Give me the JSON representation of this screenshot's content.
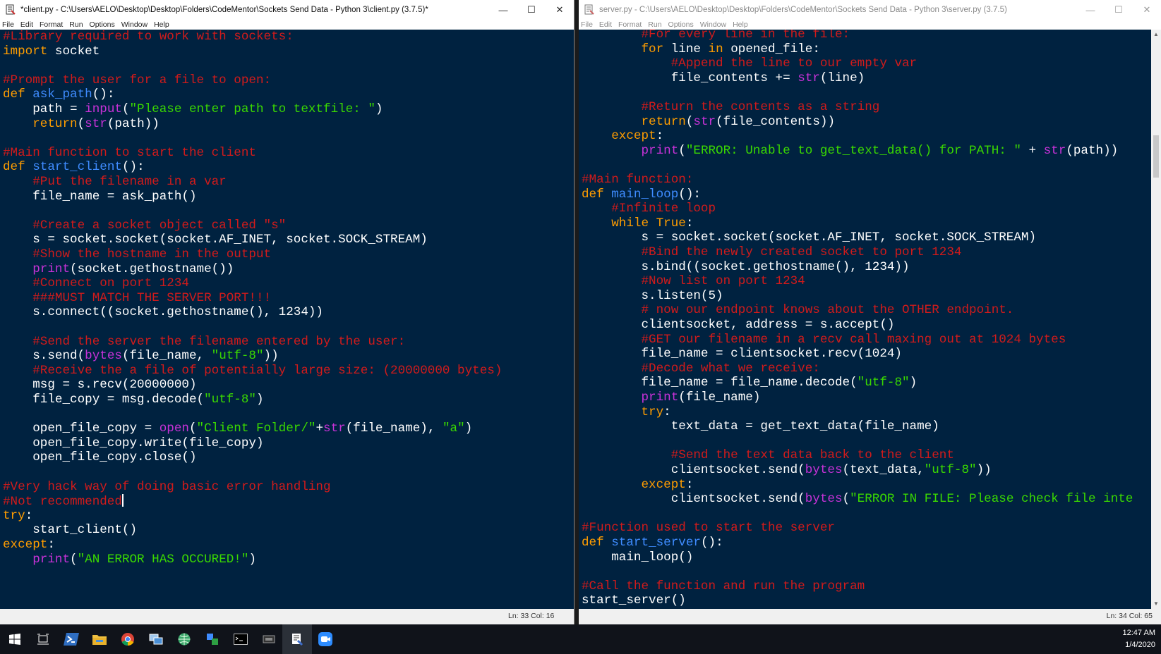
{
  "left_window": {
    "title": "*client.py - C:\\Users\\AELO\\Desktop\\Desktop\\Folders\\CodeMentor\\Sockets Send Data - Python 3\\client.py (3.7.5)*",
    "menu": [
      "File",
      "Edit",
      "Format",
      "Run",
      "Options",
      "Window",
      "Help"
    ],
    "controls": {
      "minimize": "—",
      "maximize": "☐",
      "close": "✕"
    },
    "status": "Ln: 33  Col: 16",
    "lines": [
      [
        [
          "c",
          "#Library required to work with sockets:"
        ]
      ],
      [
        [
          "k",
          "import"
        ],
        [
          "t",
          " socket"
        ]
      ],
      [],
      [
        [
          "c",
          "#Prompt the user for a file to open:"
        ]
      ],
      [
        [
          "k",
          "def"
        ],
        [
          "t",
          " "
        ],
        [
          "d",
          "ask_path"
        ],
        [
          "t",
          "():"
        ]
      ],
      [
        [
          "t",
          "    path = "
        ],
        [
          "b",
          "input"
        ],
        [
          "t",
          "("
        ],
        [
          "s",
          "\"Please enter path to textfile: \""
        ],
        [
          "t",
          ")"
        ]
      ],
      [
        [
          "t",
          "    "
        ],
        [
          "k",
          "return"
        ],
        [
          "t",
          "("
        ],
        [
          "b",
          "str"
        ],
        [
          "t",
          "(path))"
        ]
      ],
      [],
      [
        [
          "c",
          "#Main function to start the client"
        ]
      ],
      [
        [
          "k",
          "def"
        ],
        [
          "t",
          " "
        ],
        [
          "d",
          "start_client"
        ],
        [
          "t",
          "():"
        ]
      ],
      [
        [
          "t",
          "    "
        ],
        [
          "c",
          "#Put the filename in a var"
        ]
      ],
      [
        [
          "t",
          "    file_name = ask_path()"
        ]
      ],
      [],
      [
        [
          "t",
          "    "
        ],
        [
          "c",
          "#Create a socket object called \"s\""
        ]
      ],
      [
        [
          "t",
          "    s = socket.socket(socket.AF_INET, socket.SOCK_STREAM)"
        ]
      ],
      [
        [
          "t",
          "    "
        ],
        [
          "c",
          "#Show the hostname in the output"
        ]
      ],
      [
        [
          "t",
          "    "
        ],
        [
          "b",
          "print"
        ],
        [
          "t",
          "(socket.gethostname())"
        ]
      ],
      [
        [
          "t",
          "    "
        ],
        [
          "c",
          "#Connect on port 1234"
        ]
      ],
      [
        [
          "t",
          "    "
        ],
        [
          "c",
          "###MUST MATCH THE SERVER PORT!!!"
        ]
      ],
      [
        [
          "t",
          "    s.connect((socket.gethostname(), 1234))"
        ]
      ],
      [],
      [
        [
          "t",
          "    "
        ],
        [
          "c",
          "#Send the server the filename entered by the user:"
        ]
      ],
      [
        [
          "t",
          "    s.send("
        ],
        [
          "b",
          "bytes"
        ],
        [
          "t",
          "(file_name, "
        ],
        [
          "s",
          "\"utf-8\""
        ],
        [
          "t",
          "))"
        ]
      ],
      [
        [
          "t",
          "    "
        ],
        [
          "c",
          "#Receive the a file of potentially large size: (20000000 bytes)"
        ]
      ],
      [
        [
          "t",
          "    msg = s.recv(20000000)"
        ]
      ],
      [
        [
          "t",
          "    file_copy = msg.decode("
        ],
        [
          "s",
          "\"utf-8\""
        ],
        [
          "t",
          ")"
        ]
      ],
      [],
      [
        [
          "t",
          "    open_file_copy = "
        ],
        [
          "b",
          "open"
        ],
        [
          "t",
          "("
        ],
        [
          "s",
          "\"Client Folder/\""
        ],
        [
          "t",
          "+"
        ],
        [
          "b",
          "str"
        ],
        [
          "t",
          "(file_name), "
        ],
        [
          "s",
          "\"a\""
        ],
        [
          "t",
          ")"
        ]
      ],
      [
        [
          "t",
          "    open_file_copy.write(file_copy)"
        ]
      ],
      [
        [
          "t",
          "    open_file_copy.close()"
        ]
      ],
      [],
      [
        [
          "c",
          "#Very hack way of doing basic error handling"
        ]
      ],
      [
        [
          "c",
          "#Not recommended"
        ],
        [
          "cursor",
          ""
        ]
      ],
      [
        [
          "k",
          "try"
        ],
        [
          "t",
          ":"
        ]
      ],
      [
        [
          "t",
          "    start_client()"
        ]
      ],
      [
        [
          "k",
          "except"
        ],
        [
          "t",
          ":"
        ]
      ],
      [
        [
          "t",
          "    "
        ],
        [
          "b",
          "print"
        ],
        [
          "t",
          "("
        ],
        [
          "s",
          "\"AN ERROR HAS OCCURED!\""
        ],
        [
          "t",
          ")"
        ]
      ]
    ]
  },
  "right_window": {
    "title": "server.py - C:\\Users\\AELO\\Desktop\\Desktop\\Folders\\CodeMentor\\Sockets Send Data - Python 3\\server.py (3.7.5)",
    "menu": [
      "File",
      "Edit",
      "Format",
      "Run",
      "Options",
      "Window",
      "Help"
    ],
    "controls": {
      "minimize": "—",
      "maximize": "☐",
      "close": "✕"
    },
    "status": "Ln: 34  Col: 65",
    "lines": [
      [
        [
          "t",
          "        "
        ],
        [
          "c",
          "#For every line in the file:"
        ]
      ],
      [
        [
          "t",
          "        "
        ],
        [
          "k",
          "for"
        ],
        [
          "t",
          " line "
        ],
        [
          "k",
          "in"
        ],
        [
          "t",
          " opened_file:"
        ]
      ],
      [
        [
          "t",
          "            "
        ],
        [
          "c",
          "#Append the line to our empty var"
        ]
      ],
      [
        [
          "t",
          "            file_contents += "
        ],
        [
          "b",
          "str"
        ],
        [
          "t",
          "(line)"
        ]
      ],
      [],
      [
        [
          "t",
          "        "
        ],
        [
          "c",
          "#Return the contents as a string"
        ]
      ],
      [
        [
          "t",
          "        "
        ],
        [
          "k",
          "return"
        ],
        [
          "t",
          "("
        ],
        [
          "b",
          "str"
        ],
        [
          "t",
          "(file_contents))"
        ]
      ],
      [
        [
          "t",
          "    "
        ],
        [
          "k",
          "except"
        ],
        [
          "t",
          ":"
        ]
      ],
      [
        [
          "t",
          "        "
        ],
        [
          "b",
          "print"
        ],
        [
          "t",
          "("
        ],
        [
          "s",
          "\"ERROR: Unable to get_text_data() for PATH: \""
        ],
        [
          "t",
          " + "
        ],
        [
          "b",
          "str"
        ],
        [
          "t",
          "(path))"
        ]
      ],
      [],
      [
        [
          "c",
          "#Main function:"
        ]
      ],
      [
        [
          "k",
          "def"
        ],
        [
          "t",
          " "
        ],
        [
          "d",
          "main_loop"
        ],
        [
          "t",
          "():"
        ]
      ],
      [
        [
          "t",
          "    "
        ],
        [
          "c",
          "#Infinite loop"
        ]
      ],
      [
        [
          "t",
          "    "
        ],
        [
          "k",
          "while"
        ],
        [
          "t",
          " "
        ],
        [
          "k",
          "True"
        ],
        [
          "t",
          ":"
        ]
      ],
      [
        [
          "t",
          "        s = socket.socket(socket.AF_INET, socket.SOCK_STREAM)"
        ]
      ],
      [
        [
          "t",
          "        "
        ],
        [
          "c",
          "#Bind the newly created socket to port 1234"
        ]
      ],
      [
        [
          "t",
          "        s.bind((socket.gethostname(), 1234))"
        ]
      ],
      [
        [
          "t",
          "        "
        ],
        [
          "c",
          "#Now list on port 1234"
        ]
      ],
      [
        [
          "t",
          "        s.listen(5)"
        ]
      ],
      [
        [
          "t",
          "        "
        ],
        [
          "c",
          "# now our endpoint knows about the OTHER endpoint."
        ]
      ],
      [
        [
          "t",
          "        clientsocket, address = s.accept()"
        ]
      ],
      [
        [
          "t",
          "        "
        ],
        [
          "c",
          "#GET our filename in a recv call maxing out at 1024 bytes"
        ]
      ],
      [
        [
          "t",
          "        file_name = clientsocket.recv(1024)"
        ]
      ],
      [
        [
          "t",
          "        "
        ],
        [
          "c",
          "#Decode what we receive:"
        ]
      ],
      [
        [
          "t",
          "        file_name = file_name.decode("
        ],
        [
          "s",
          "\"utf-8\""
        ],
        [
          "t",
          ")"
        ]
      ],
      [
        [
          "t",
          "        "
        ],
        [
          "b",
          "print"
        ],
        [
          "t",
          "(file_name)"
        ]
      ],
      [
        [
          "t",
          "        "
        ],
        [
          "k",
          "try"
        ],
        [
          "t",
          ":"
        ]
      ],
      [
        [
          "t",
          "            text_data = get_text_data(file_name)"
        ]
      ],
      [],
      [
        [
          "t",
          "            "
        ],
        [
          "c",
          "#Send the text data back to the client"
        ]
      ],
      [
        [
          "t",
          "            clientsocket.send("
        ],
        [
          "b",
          "bytes"
        ],
        [
          "t",
          "(text_data,"
        ],
        [
          "s",
          "\"utf-8\""
        ],
        [
          "t",
          "))"
        ]
      ],
      [
        [
          "t",
          "        "
        ],
        [
          "k",
          "except"
        ],
        [
          "t",
          ":"
        ]
      ],
      [
        [
          "t",
          "            clientsocket.send("
        ],
        [
          "b",
          "bytes"
        ],
        [
          "t",
          "("
        ],
        [
          "s",
          "\"ERROR IN FILE: Please check file inte"
        ]
      ],
      [],
      [
        [
          "c",
          "#Function used to start the server"
        ]
      ],
      [
        [
          "k",
          "def"
        ],
        [
          "t",
          " "
        ],
        [
          "d",
          "start_server"
        ],
        [
          "t",
          "():"
        ]
      ],
      [
        [
          "t",
          "    main_loop()"
        ]
      ],
      [],
      [
        [
          "c",
          "#Call the function and run the program"
        ]
      ],
      [
        [
          "t",
          "start_server()"
        ]
      ]
    ]
  },
  "syntax_colors": {
    "background": "#002240",
    "comment": "#d11b1b",
    "keyword": "#ff9d00",
    "builtin": "#c832d8",
    "definition": "#3f8cff",
    "string": "#3ad900",
    "text": "#ffffff"
  },
  "taskbar": {
    "icons": [
      "windows-start-icon",
      "task-view-icon",
      "powershell-icon",
      "file-explorer-icon",
      "chrome-icon",
      "remote-desktop-icon",
      "network-globe-icon",
      "people-network-icon",
      "terminal-icon",
      "settings-app-icon",
      "idle-python-icon",
      "zoom-icon"
    ],
    "active_icon": "idle-python-icon",
    "clock_time": "12:47 AM",
    "clock_date": "1/4/2020"
  }
}
